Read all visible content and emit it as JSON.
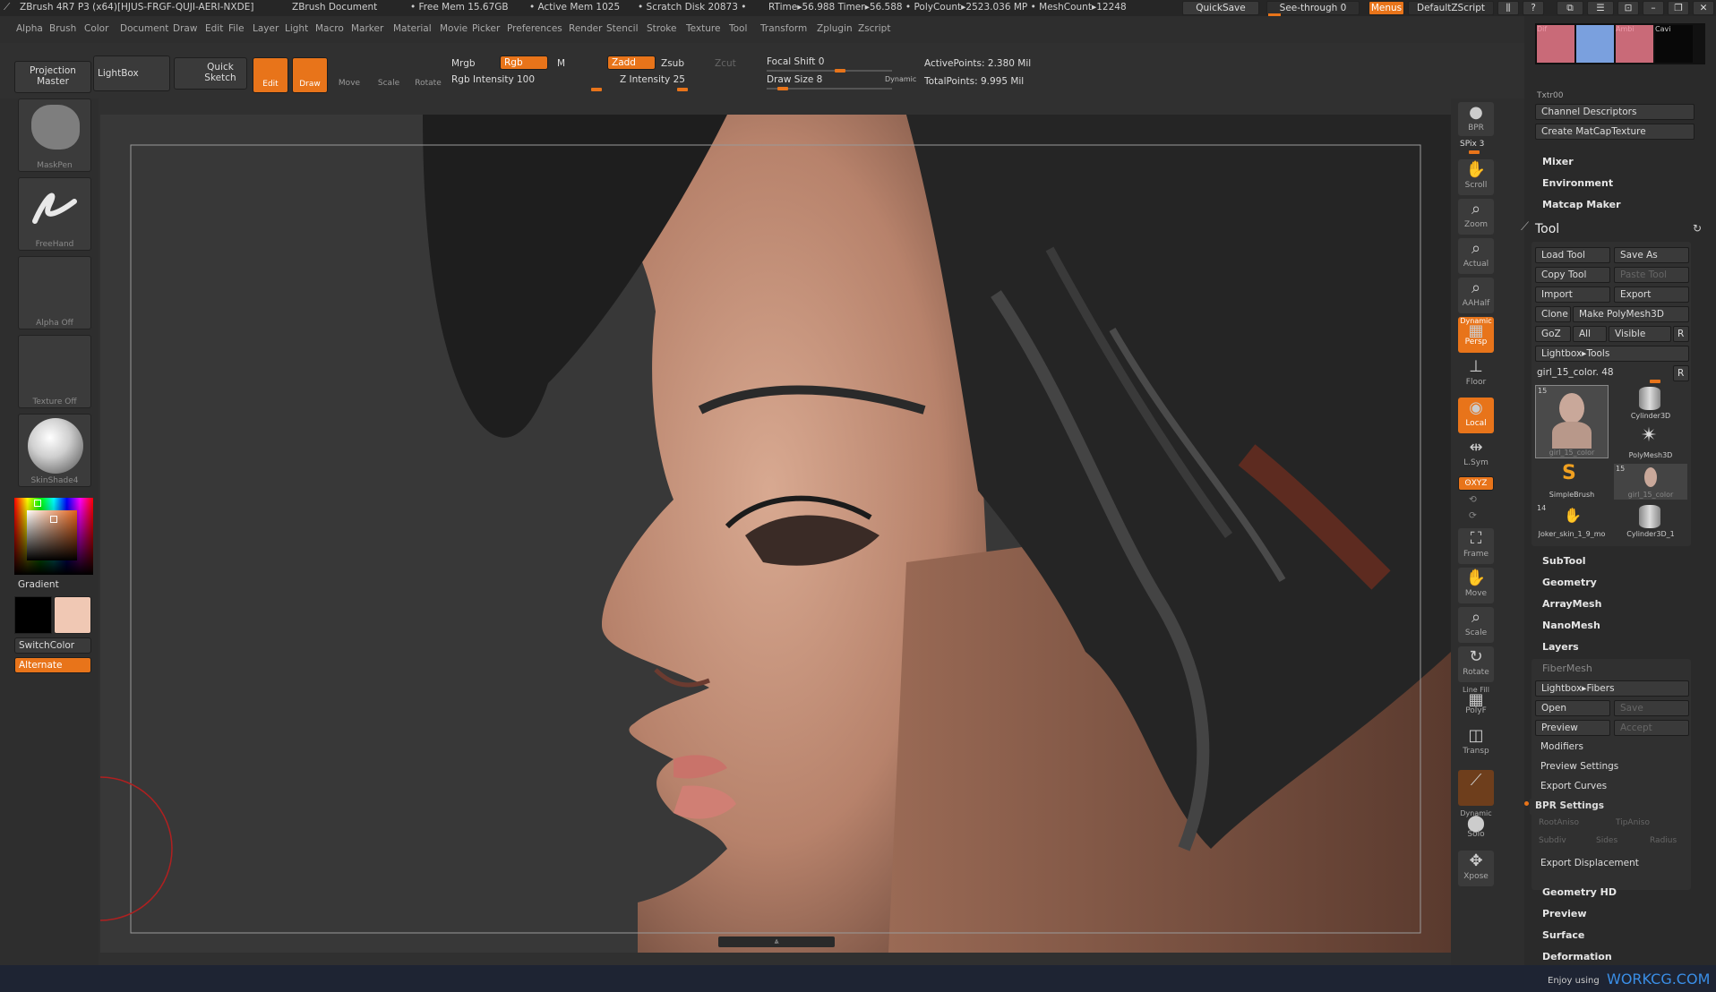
{
  "titlebar": {
    "app": "ZBrush 4R7 P3 (x64)[HJUS-FRGF-QUJI-AERI-NXDE]",
    "doc": "ZBrush Document",
    "free_mem": "• Free Mem 15.67GB",
    "active_mem": "• Active Mem 1025",
    "scratch": "• Scratch Disk 20873 •",
    "rtime": "RTime▸56.988 Timer▸56.588 • PolyCount▸2523.036 MP • MeshCount▸12248",
    "quicksave": "QuickSave",
    "seethrough": "See-through  0",
    "menus": "Menus",
    "script": "DefaultZScript"
  },
  "menubar": [
    "Alpha",
    "Brush",
    "Color",
    "Document",
    "Draw",
    "Edit",
    "File",
    "Layer",
    "Light",
    "Macro",
    "Marker",
    "Material",
    "Movie",
    "Picker",
    "Preferences",
    "Render",
    "Stencil",
    "Stroke",
    "Texture",
    "Tool",
    "Transform",
    "Zplugin",
    "Zscript"
  ],
  "toolbar": {
    "projection_master": "Projection Master",
    "lightbox": "LightBox",
    "quick_sketch": "Quick Sketch",
    "edit": "Edit",
    "draw": "Draw",
    "move": "Move",
    "scale": "Scale",
    "rotate": "Rotate",
    "mrgb": "Mrgb",
    "rgb": "Rgb",
    "m": "M",
    "rgb_intensity": "Rgb Intensity 100",
    "zadd": "Zadd",
    "zsub": "Zsub",
    "zcut": "Zcut",
    "z_intensity": "Z Intensity 25",
    "focal_shift": "Focal Shift 0",
    "draw_size": "Draw Size 8",
    "dynamic": "Dynamic",
    "active_points": "ActivePoints: 2.380 Mil",
    "total_points": "TotalPoints: 9.995 Mil"
  },
  "leftshelf": {
    "brush": "MaskPen",
    "stroke": "FreeHand",
    "alpha": "Alpha Off",
    "texture": "Texture Off",
    "material": "SkinShade4",
    "gradient": "Gradient",
    "switchcolor": "SwitchColor",
    "alternate": "Alternate",
    "color_main": "#f0c8b4",
    "color_secondary": "#000000"
  },
  "rightshelf": {
    "bpr": "BPR",
    "spix": "SPix 3",
    "scroll": "Scroll",
    "zoom": "Zoom",
    "actual": "Actual",
    "aahalf": "AAHalf",
    "dynamic": "Dynamic",
    "persp": "Persp",
    "floor": "Floor",
    "local": "Local",
    "lsym": "L.Sym",
    "xyz": "ʘXYZ",
    "frame": "Frame",
    "move": "Move",
    "scale": "Scale",
    "rotate": "Rotate",
    "linefill": "Line Fill",
    "polyf": "PolyF",
    "transp": "Transp",
    "dynamic2": "Dynamic",
    "solo": "Solo",
    "xpose": "Xpose"
  },
  "rightpanel": {
    "swatches": [
      "Dif",
      "",
      "Ambi",
      "Cavi"
    ],
    "txtr": "Txtr00",
    "channel_desc": "Channel Descriptors",
    "create_matcap": "Create MatCapTexture",
    "mixer": "Mixer",
    "environment": "Environment",
    "matcap_maker": "Matcap Maker",
    "tool_title": "Tool",
    "load_tool": "Load Tool",
    "save_as": "Save As",
    "copy_tool": "Copy Tool",
    "paste_tool": "Paste Tool",
    "import": "Import",
    "export": "Export",
    "clone": "Clone",
    "make_polymesh": "Make PolyMesh3D",
    "goz": "GoZ",
    "all": "All",
    "visible": "Visible",
    "r": "R",
    "lightbox_tools": "Lightbox▸Tools",
    "current_tool": "girl_15_color. 48",
    "tools": [
      {
        "name": "girl_15_color",
        "count": "15"
      },
      {
        "name": "Cylinder3D",
        "count": ""
      },
      {
        "name": "PolyMesh3D",
        "count": ""
      },
      {
        "name": "SimpleBrush",
        "count": ""
      },
      {
        "name": "girl_15_color",
        "count": "15"
      },
      {
        "name": "Joker_skin_1_9_mo",
        "count": "14"
      },
      {
        "name": "Cylinder3D_1",
        "count": ""
      }
    ],
    "subtool": "SubTool",
    "geometry": "Geometry",
    "arraymesh": "ArrayMesh",
    "nanomesh": "NanoMesh",
    "layers": "Layers",
    "fibermesh": "FiberMesh",
    "lightbox_fibers": "Lightbox▸Fibers",
    "open": "Open",
    "save": "Save",
    "preview": "Preview",
    "accept": "Accept",
    "modifiers": "Modifiers",
    "preview_settings": "Preview Settings",
    "export_curves": "Export Curves",
    "bpr_settings": "BPR Settings",
    "rootaniso": "RootAniso",
    "tipaniso": "TipAniso",
    "subdiv": "Subdiv",
    "sides": "Sides",
    "radius": "Radius",
    "export_displacement": "Export Displacement",
    "geometry_hd": "Geometry HD",
    "preview2": "Preview",
    "surface": "Surface",
    "deformation": "Deformation"
  },
  "footer": {
    "enjoy": "Enjoy using",
    "brand": "WORKCG.COM"
  }
}
